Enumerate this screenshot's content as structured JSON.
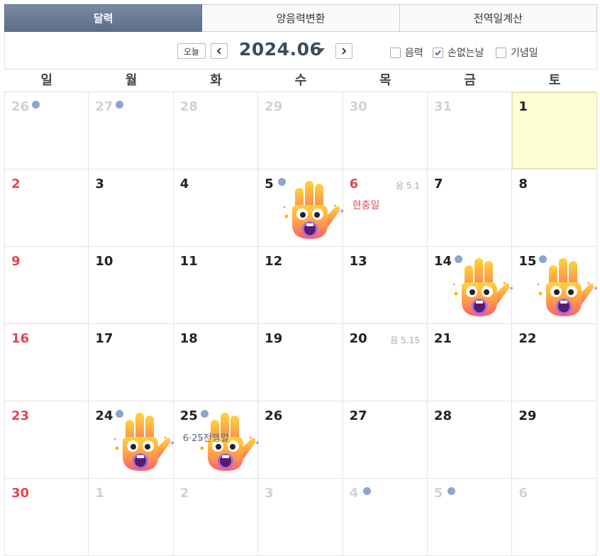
{
  "tabs": [
    {
      "label": "달력",
      "active": true
    },
    {
      "label": "양음력변환",
      "active": false
    },
    {
      "label": "전역일계산",
      "active": false
    }
  ],
  "toolbar": {
    "today_label": "오늘",
    "prev_icon": "chevron-left-icon",
    "next_icon": "chevron-right-icon",
    "month_title": "2024.06",
    "options": [
      {
        "label": "음력",
        "checked": false
      },
      {
        "label": "손없는날",
        "checked": true
      },
      {
        "label": "기념일",
        "checked": false
      }
    ]
  },
  "colors": {
    "sunday": "#e0474f",
    "dot": "#8ea4cf",
    "today_bg": "#ffffd6",
    "tab_active": "#5c6e88"
  },
  "weekdays": [
    "일",
    "월",
    "화",
    "수",
    "목",
    "금",
    "토"
  ],
  "weeks": [
    [
      {
        "day": "26",
        "other": true,
        "dot": true
      },
      {
        "day": "27",
        "other": true,
        "dot": true
      },
      {
        "day": "28",
        "other": true
      },
      {
        "day": "29",
        "other": true
      },
      {
        "day": "30",
        "other": true
      },
      {
        "day": "31",
        "other": true
      },
      {
        "day": "1",
        "today": true
      }
    ],
    [
      {
        "day": "2",
        "sunday": true
      },
      {
        "day": "3"
      },
      {
        "day": "4"
      },
      {
        "day": "5",
        "dot": true,
        "hand": true
      },
      {
        "day": "6",
        "sunday": true,
        "lunar": "음 5.1",
        "holiday": "현충일"
      },
      {
        "day": "7"
      },
      {
        "day": "8"
      }
    ],
    [
      {
        "day": "9",
        "sunday": true
      },
      {
        "day": "10"
      },
      {
        "day": "11"
      },
      {
        "day": "12"
      },
      {
        "day": "13"
      },
      {
        "day": "14",
        "dot": true,
        "hand": true
      },
      {
        "day": "15",
        "dot": true,
        "hand": true
      }
    ],
    [
      {
        "day": "16",
        "sunday": true
      },
      {
        "day": "17"
      },
      {
        "day": "18"
      },
      {
        "day": "19"
      },
      {
        "day": "20",
        "lunar": "음 5.15"
      },
      {
        "day": "21"
      },
      {
        "day": "22"
      }
    ],
    [
      {
        "day": "23",
        "sunday": true
      },
      {
        "day": "24",
        "dot": true,
        "hand": true
      },
      {
        "day": "25",
        "dot": true,
        "hand": true,
        "event": "6·25전쟁일"
      },
      {
        "day": "26"
      },
      {
        "day": "27"
      },
      {
        "day": "28"
      },
      {
        "day": "29"
      }
    ],
    [
      {
        "day": "30",
        "sunday": true
      },
      {
        "day": "1",
        "other": true
      },
      {
        "day": "2",
        "other": true
      },
      {
        "day": "3",
        "other": true
      },
      {
        "day": "4",
        "other": true,
        "dot": true
      },
      {
        "day": "5",
        "other": true,
        "dot": true
      },
      {
        "day": "6",
        "other": true
      }
    ]
  ]
}
